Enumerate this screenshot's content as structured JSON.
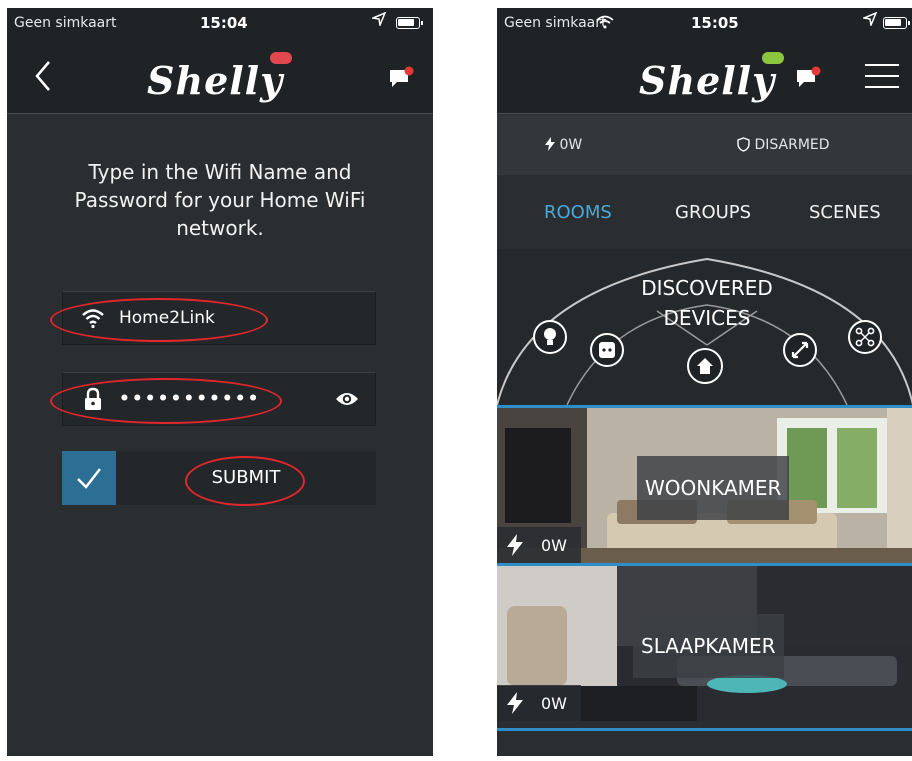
{
  "left_screen": {
    "status": {
      "carrier": "Geen simkaart",
      "time": "15:04"
    },
    "header": {
      "logo": "Shelly"
    },
    "instructions": "Type in the Wifi Name and Password for your Home WiFi network.",
    "wifi_field": {
      "value": "Home2Link",
      "icon": "wifi-icon"
    },
    "password_field": {
      "value": "•••••••••••",
      "icon": "lock-icon",
      "toggle_icon": "eye-icon"
    },
    "submit": {
      "label": "SUBMIT",
      "checkbox_checked": true
    }
  },
  "right_screen": {
    "status": {
      "carrier": "Geen simkaart",
      "time": "15:05"
    },
    "header": {
      "logo": "Shelly"
    },
    "power_status": "0W",
    "alarm_status": "DISARMED",
    "tabs": [
      {
        "label": "ROOMS",
        "active": true
      },
      {
        "label": "GROUPS",
        "active": false
      },
      {
        "label": "SCENES",
        "active": false
      }
    ],
    "discovered": {
      "title": "DISCOVERED DEVICES"
    },
    "rooms": [
      {
        "name": "WOONKAMER",
        "power": "0W"
      },
      {
        "name": "SLAAPKAMER",
        "power": "0W"
      }
    ]
  },
  "colors": {
    "background": "#2b2e30",
    "header": "#1f2326",
    "accent_blue": "#2e8ec8",
    "active_tab": "#49a9dc",
    "annotation_red": "#e1262c",
    "cloud_red": "#e0474f",
    "cloud_green": "#8cc63f"
  }
}
